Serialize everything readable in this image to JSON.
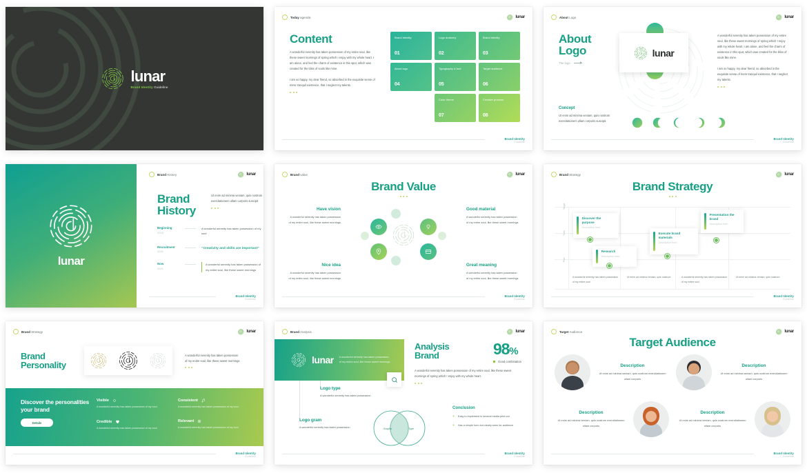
{
  "brand": {
    "name": "lunar",
    "logo_icon": "lunar-spiral-logo-icon",
    "footer_title": "Brand Identity",
    "footer_sub": "Guideline"
  },
  "colors": {
    "accent": "#18a085",
    "teal": "#17a28c",
    "lime": "#a9ca4e",
    "green": "#8cc63f",
    "dark": "#343634"
  },
  "slides": [
    {
      "id": "cover",
      "title": "lunar",
      "tagline_strong": "Brand Identity",
      "tagline_rest": " Guideline"
    },
    {
      "id": "content",
      "crumb_bold": "Today",
      "crumb_rest": " agenda",
      "heading": "Content",
      "paragraph1": "A wonderful serenity has taken possession of my entire soul, like these sweet mornings of spring which I enjoy with my whole heart. I am alone, and feel the charm of existence in this spot, which was created for the bliss of souls like mine.",
      "paragraph2": "I am so happy, my dear friend, so absorbed in the exquisite sense of mere tranquil existence, that I neglect my talents.",
      "cards": [
        {
          "label": "Brand identity",
          "number": "01"
        },
        {
          "label": "Logo anatomy",
          "number": "02"
        },
        {
          "label": "Brand identity",
          "number": "03"
        },
        {
          "label": "About logo",
          "number": "04"
        },
        {
          "label": "Typography & font",
          "number": "05"
        },
        {
          "label": "Target audience",
          "number": "06"
        },
        {
          "label": "Color theme",
          "number": "07"
        },
        {
          "label": "Creative process",
          "number": "08"
        }
      ]
    },
    {
      "id": "about-logo",
      "crumb_bold": "About",
      "crumb_rest": " Logo",
      "heading_l1": "About",
      "heading_l2": "Logo",
      "link_label": "The logo",
      "card_word": "lunar",
      "paragraph1": "A wonderful serenity has taken possession of my entire soul, like these sweet mornings of spring which I enjoy with my whole heart. I am alone, and feel the charm of existence in this spot, which was created for the bliss of souls like mine.",
      "paragraph2": "I am so happy, my dear friend, so absorbed in the exquisite sense of mere tranquil existence, that I neglect my talents.",
      "concept_title": "Concept",
      "concept_text": "Ut enim ad minima veniam, quis nostrum exercitationem ullam corporis suscipit."
    },
    {
      "id": "brand-history",
      "crumb_bold": "Brand",
      "crumb_rest": " History",
      "panel_word": "lunar",
      "heading_l1": "Brand",
      "heading_l2": "History",
      "intro": "Ut enim ad minima veniam, quis nostrum exercitationem ullam corporis suscipit",
      "timeline": [
        {
          "key": "Beginning",
          "date": "2018",
          "text": "A wonderful serenity has taken possession of my soul",
          "style": "plain"
        },
        {
          "key": "Recruitment",
          "date": "2020",
          "text": "“Creativity and skills are important”",
          "style": "quote"
        },
        {
          "key": "Now",
          "date": "2021",
          "text": "A wonderful serenity has taken possession of my entire soul, like these sweet mornings",
          "style": "bar"
        }
      ]
    },
    {
      "id": "brand-value",
      "crumb_bold": "Brand",
      "crumb_rest": " value",
      "heading": "Brand Value",
      "quadrants": [
        {
          "title": "Have vision",
          "text": "A wonderful serenity has taken possession of my entire soul, like these sweet mornings"
        },
        {
          "title": "Good material",
          "text": "A wonderful serenity has taken possession of my entire soul, like these sweet mornings"
        },
        {
          "title": "Nice idea",
          "text": "A wonderful serenity has taken possession of my entire soul, like these sweet mornings"
        },
        {
          "title": "Great meaning",
          "text": "A wonderful serenity has taken possession of my entire soul, like these sweet mornings"
        }
      ]
    },
    {
      "id": "brand-strategy",
      "crumb_bold": "Brand",
      "crumb_rest": " Strategy",
      "heading": "Brand Strategy",
      "axis_labels": [
        "Target",
        "Tools",
        "Plan"
      ],
      "cards": [
        {
          "title": "Discover the purpose",
          "desc": "Description here"
        },
        {
          "title": "Research",
          "desc": "Description here"
        },
        {
          "title": "Execute brand materials",
          "desc": "Description here"
        },
        {
          "title": "Presentation the brand",
          "desc": "Description here"
        }
      ],
      "bottom_notes": [
        "A wonderful serenity has taken possession of my entire soul",
        "Ut enim ad minima veniam, quis nostrum",
        "A wonderful serenity has taken possession of my entire soul",
        "Ut enim ad minima veniam, quis nostrum"
      ]
    },
    {
      "id": "brand-personality",
      "crumb_bold": "Brand",
      "crumb_rest": " Strategy",
      "heading_l1": "Brand",
      "heading_l2": "Personality",
      "intro": "A wonderful serenity has taken possession of my entire soul, like these sweet mornings",
      "band_title": "Discover the personalities your brand",
      "button": "Details",
      "traits": [
        {
          "title": "Visible",
          "icon": "eye-icon",
          "text": "A wonderful serenity has taken possession of my soul"
        },
        {
          "title": "Consistent",
          "icon": "note-icon",
          "text": "A wonderful serenity has taken possession of my soul"
        },
        {
          "title": "Credible",
          "icon": "heart-icon",
          "text": "A wonderful serenity has taken possession of my soul"
        },
        {
          "title": "Relevant",
          "icon": "target-icon",
          "text": "A wonderful serenity has taken possession of my soul"
        }
      ]
    },
    {
      "id": "analysis-brand",
      "crumb_bold": "Brand",
      "crumb_rest": " Analysis",
      "band_word": "lunar",
      "band_text": "A wonderful serenity has taken possession of my entire soul, like these sweet mornings",
      "heading_l1": "Analysis",
      "heading_l2": "Brand",
      "stat_value": "98",
      "stat_unit": "%",
      "stat_label": "Good combination",
      "paragraph": "A wonderful serenity has taken possession of my entire soul, like these sweet mornings of spring which I enjoy with my whole heart.",
      "keys": [
        {
          "title": "Logo type",
          "text": "A wonderful serenity has taken possession"
        },
        {
          "title": "Logo gram",
          "text": "A wonderful serenity has taken possession"
        }
      ],
      "venn": {
        "left": "Graphic",
        "right": "Type"
      },
      "conclusion_title": "Conclusion",
      "conclusion_items": [
        "Easy to implement in several media print out",
        "Has a simple form but clearly seen for audience"
      ]
    },
    {
      "id": "target-audience",
      "crumb_bold": "Target",
      "crumb_rest": " Audience",
      "heading": "Target Audience",
      "people": [
        {
          "title": "Description",
          "text": "Ut enim ad minima veniam, quis nostrum exercitationem ullam corporis",
          "avatar": "man-beard-avatar"
        },
        {
          "title": "Description",
          "text": "Ut enim ad minima veniam, quis nostrum exercitationem ullam corporis",
          "avatar": "man-young-avatar"
        },
        {
          "title": "Description",
          "text": "Ut enim ad minima veniam, quis nostrum exercitationem ullam corporis",
          "avatar": "woman-redhead-avatar"
        },
        {
          "title": "Description",
          "text": "Ut enim ad minima veniam, quis nostrum exercitationem ullam corporis",
          "avatar": "woman-blonde-avatar"
        }
      ]
    }
  ]
}
